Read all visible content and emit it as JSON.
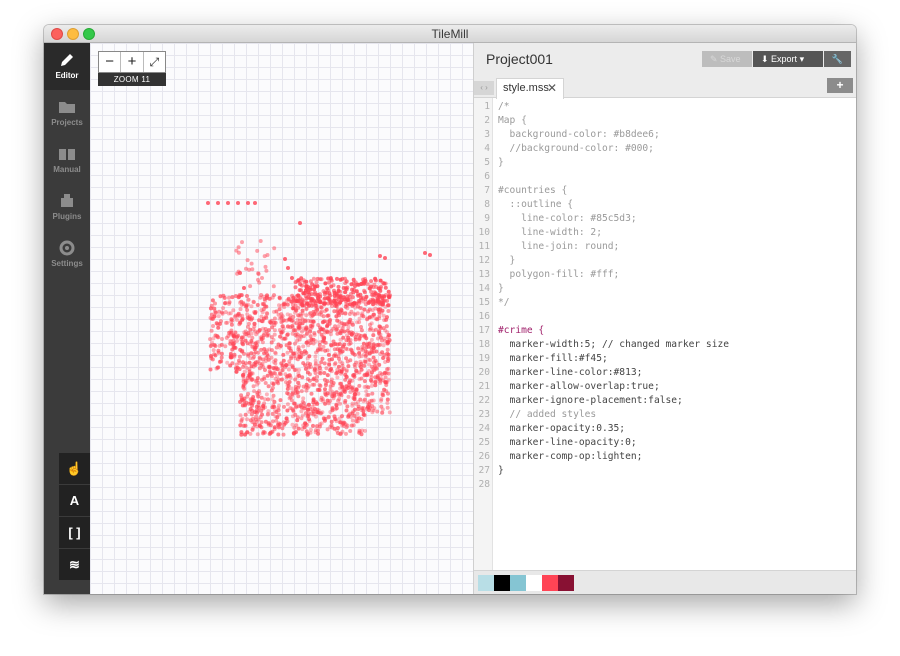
{
  "app": {
    "title": "TileMill",
    "accent": "#f45",
    "sidebar_bg": "#3b3b3b"
  },
  "sidebar": {
    "items": [
      {
        "label": "Editor",
        "icon": "pencil-icon",
        "active": true
      },
      {
        "label": "Projects",
        "icon": "folder-icon",
        "active": false
      },
      {
        "label": "Manual",
        "icon": "book-icon",
        "active": false
      },
      {
        "label": "Plugins",
        "icon": "puzzle-icon",
        "active": false
      },
      {
        "label": "Settings",
        "icon": "gear-icon",
        "active": false
      }
    ],
    "tools": [
      {
        "name": "pointer-tool",
        "glyph": "☝"
      },
      {
        "name": "text-tool",
        "glyph": "A"
      },
      {
        "name": "bracket-tool",
        "glyph": "[ ]"
      },
      {
        "name": "layers-tool",
        "glyph": "≋"
      }
    ]
  },
  "map": {
    "zoom_in": "−",
    "zoom_plus": "+",
    "fullscreen": "⤢",
    "zoom_label": "ZOOM 11"
  },
  "editor": {
    "project_title": "Project001",
    "save_label": "Save",
    "export_label": "Export",
    "tab_name": "style.mss",
    "tab_close": "✕",
    "add_tab": "+",
    "tab_prev": "‹",
    "tab_next": "›",
    "code_lines": [
      "/*",
      "Map {",
      "  background-color: #b8dee6;",
      "  //background-color: #000;",
      "}",
      "",
      "#countries {",
      "  ::outline {",
      "    line-color: #85c5d3;",
      "    line-width: 2;",
      "    line-join: round;",
      "  }",
      "  polygon-fill: #fff;",
      "}",
      "*/",
      "",
      "#crime {",
      "  marker-width:5; // changed marker size",
      "  marker-fill:#f45;",
      "  marker-line-color:#813;",
      "  marker-allow-overlap:true;",
      "  marker-ignore-placement:false;",
      "  // added styles",
      "  marker-opacity:0.35;",
      "  marker-line-opacity:0;",
      "  marker-comp-op:lighten;",
      "}",
      ""
    ],
    "swatches": [
      "#b8dee6",
      "#000000",
      "#85c5d3",
      "#ffffff",
      "#ff4455",
      "#881133"
    ]
  }
}
